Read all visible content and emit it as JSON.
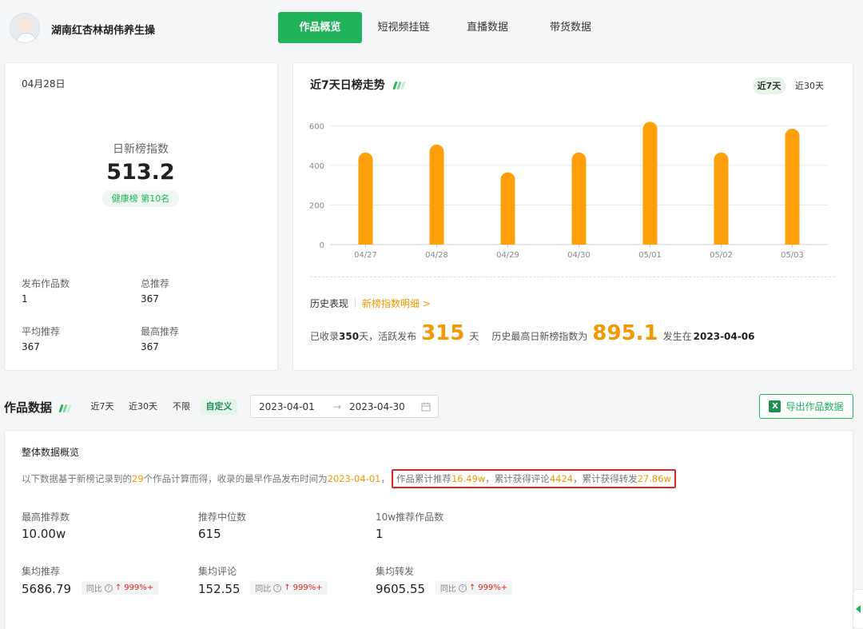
{
  "header": {
    "account_name": "湖南红杏林胡伟养生操",
    "tabs": [
      {
        "label": "作品概览",
        "active": true
      },
      {
        "label": "短视频挂链",
        "active": false
      },
      {
        "label": "直播数据",
        "active": false
      },
      {
        "label": "带货数据",
        "active": false
      }
    ]
  },
  "daily_card": {
    "date": "04月28日",
    "index_label": "日新榜指数",
    "index_value": "513.2",
    "rank_badge": "健康榜 第10名",
    "stats": [
      {
        "label": "发布作品数",
        "value": "1"
      },
      {
        "label": "总推荐",
        "value": "367"
      },
      {
        "label": "平均推荐",
        "value": "367"
      },
      {
        "label": "最高推荐",
        "value": "367"
      }
    ]
  },
  "trend_card": {
    "title": "近7天日榜走势",
    "range_options": [
      {
        "label": "近7天",
        "active": true
      },
      {
        "label": "近30天",
        "active": false
      }
    ],
    "history_label": "历史表现",
    "history_link": "新榜指数明细 >",
    "history_line": {
      "p1": "已收录",
      "days": "350",
      "p2": "天，活跃发布",
      "active_days": "315",
      "p3": "天",
      "p4": "历史最高日新榜指数为",
      "max_index": "895.1",
      "p5": "发生在",
      "max_date": "2023-04-06"
    }
  },
  "chart_data": {
    "type": "bar",
    "title": "近7天日榜走势",
    "categories": [
      "04/27",
      "04/28",
      "04/29",
      "04/30",
      "05/01",
      "05/02",
      "05/03"
    ],
    "values": [
      465,
      505,
      365,
      465,
      620,
      465,
      585
    ],
    "ylim": [
      0,
      650
    ],
    "yticks": [
      0,
      200,
      400,
      600
    ],
    "grid": true,
    "bar_color": "#ff9f0a"
  },
  "works": {
    "title": "作品数据",
    "filters": [
      {
        "label": "近7天",
        "active": false
      },
      {
        "label": "近30天",
        "active": false
      },
      {
        "label": "不限",
        "active": false
      },
      {
        "label": "自定义",
        "active": true
      }
    ],
    "date_start": "2023-04-01",
    "date_arrow": "→",
    "date_end": "2023-04-30",
    "export_label": "导出作品数据",
    "overview_title": "整体数据概览",
    "desc": {
      "p1": "以下数据基于新榜记录到的",
      "count": "29",
      "p2": "个作品计算而得，收录的最早作品发布时间为",
      "earliest": "2023-04-01",
      "p3": "，",
      "h1": "作品累计推荐",
      "total_rec": "16.49w",
      "h2": "，累计获得评论",
      "total_comments": "4424",
      "h3": "，累计获得转发",
      "total_shares": "27.86w"
    },
    "metrics": [
      {
        "label": "最高推荐数",
        "value": "10.00w"
      },
      {
        "label": "推荐中位数",
        "value": "615"
      },
      {
        "label": "10w推荐作品数",
        "value": "1"
      },
      {
        "label": "集均推荐",
        "value": "5686.79",
        "yoy_label": "同比",
        "yoy_value": "999%+"
      },
      {
        "label": "集均评论",
        "value": "152.55",
        "yoy_label": "同比",
        "yoy_value": "999%+"
      },
      {
        "label": "集均转发",
        "value": "9605.55",
        "yoy_label": "同比",
        "yoy_value": "999%+"
      }
    ]
  },
  "colors": {
    "brand_green": "#20b35c",
    "accent_orange": "#f39800",
    "highlight_red": "#e0261b"
  }
}
